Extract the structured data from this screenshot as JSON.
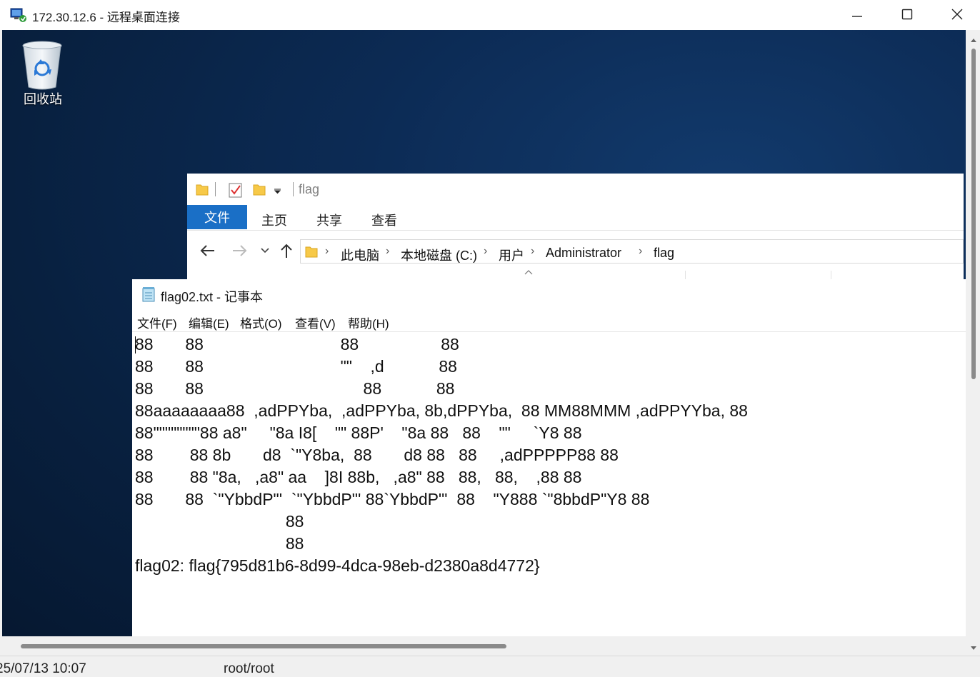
{
  "rdp": {
    "title": "172.30.12.6 - 远程桌面连接"
  },
  "desktop": {
    "recycle_bin_label": "回收站"
  },
  "explorer": {
    "folder_title": "flag",
    "tabs": [
      "文件",
      "主页",
      "共享",
      "查看"
    ],
    "breadcrumbs": [
      "此电脑",
      "本地磁盘 (C:)",
      "用户",
      "Administrator",
      "flag"
    ]
  },
  "notepad": {
    "title": "flag02.txt - 记事本",
    "menu": [
      "文件(F)",
      "编辑(E)",
      "格式(O)",
      "查看(V)",
      "帮助(H)"
    ],
    "lines": [
      "88       88                              88                  88",
      "88       88                              \"\"    ,d            88",
      "88       88                                   88            88",
      "88aaaaaaaa88  ,adPPYba,  ,adPPYba, 8b,dPPYba,  88 MM88MMM ,adPPYYba, 88",
      "88\"\"\"\"\"\"\"\"88 a8\"     \"8a I8[    \"\" 88P'    \"8a 88   88    \"\"     `Y8 88",
      "88        88 8b       d8  `\"Y8ba,  88       d8 88   88     ,adPPPPP88 88",
      "88        88 \"8a,   ,a8\" aa    ]8I 88b,   ,a8\" 88   88,   88,    ,88 88",
      "88       88  `\"YbbdP\"'  `\"YbbdP\"' 88`YbbdP\"'  88    \"Y888 `\"8bbdP\"Y8 88",
      "                                 88",
      "                                 88",
      "flag02: flag{795d81b6-8d99-4dca-98eb-d2380a8d4772}"
    ]
  },
  "statusbar": {
    "time": "25/07/13 10:07",
    "user": "root/root"
  }
}
